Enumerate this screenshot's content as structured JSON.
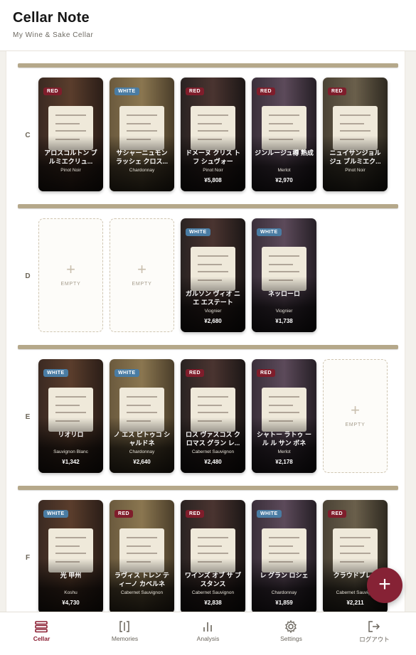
{
  "header": {
    "title": "Cellar Note",
    "subtitle": "My Wine & Sake Cellar"
  },
  "empty_label": "EMPTY",
  "empty_plus": "+",
  "fab_label": "+",
  "colors": {
    "accent": "#862235",
    "red_badge": "#7f1d2b",
    "white_badge": "#4a7ca3",
    "shelf": "#b5a88a"
  },
  "rows": [
    {
      "label": "C",
      "slots": [
        {
          "empty": false,
          "badge": "RED",
          "type": "red",
          "name": "アロスコルトン ブルミエクリュ...",
          "variety": "Pinot Noir",
          "price": ""
        },
        {
          "empty": false,
          "badge": "WHITE",
          "type": "white",
          "name": "サシャーニュモン ラッシェ クロス...",
          "variety": "Chardonnay",
          "price": ""
        },
        {
          "empty": false,
          "badge": "RED",
          "type": "red",
          "name": "ドメーヌ クリス トフ シュヴォー",
          "variety": "Pinot Noir",
          "price": "¥5,808"
        },
        {
          "empty": false,
          "badge": "RED",
          "type": "red",
          "name": "ジンルージュ樽 熟成",
          "variety": "Merlot",
          "price": "¥2,970"
        },
        {
          "empty": false,
          "badge": "RED",
          "type": "red",
          "name": "ニュイサンジョル ジュ ブルミエク...",
          "variety": "Pinot Noir",
          "price": ""
        }
      ]
    },
    {
      "label": "D",
      "slots": [
        {
          "empty": true
        },
        {
          "empty": true
        },
        {
          "empty": false,
          "badge": "WHITE",
          "type": "white",
          "name": "ガルソン ヴィオ ニエ エステート",
          "variety": "Viognier",
          "price": "¥2,680"
        },
        {
          "empty": false,
          "badge": "WHITE",
          "type": "white",
          "name": "ネッローロ",
          "variety": "Viognier",
          "price": "¥1,738"
        }
      ]
    },
    {
      "label": "E",
      "slots": [
        {
          "empty": false,
          "badge": "WHITE",
          "type": "white",
          "name": "リオリロ",
          "variety": "Sauvignon Blanc",
          "price": "¥1,342"
        },
        {
          "empty": false,
          "badge": "WHITE",
          "type": "white",
          "name": "ノ エス ピトゥコ シャルドネ",
          "variety": "Chardonnay",
          "price": "¥2,640"
        },
        {
          "empty": false,
          "badge": "RED",
          "type": "red",
          "name": "ロス ヴァスコス ク ロマス グラン レ...",
          "variety": "Cabernet Sauvignon",
          "price": "¥2,480"
        },
        {
          "empty": false,
          "badge": "RED",
          "type": "red",
          "name": "シャトー ラトゥ ール ル サン ボネ",
          "variety": "Merlot",
          "price": "¥2,178"
        },
        {
          "empty": true
        }
      ]
    },
    {
      "label": "F",
      "slots": [
        {
          "empty": false,
          "badge": "WHITE",
          "type": "white",
          "name": "光 甲州",
          "variety": "Koshu",
          "price": "¥4,730"
        },
        {
          "empty": false,
          "badge": "RED",
          "type": "red",
          "name": "ラヴィス トレン ティーノ カベルネ",
          "variety": "Cabernet Sauvignon",
          "price": ""
        },
        {
          "empty": false,
          "badge": "RED",
          "type": "red",
          "name": "ワインズ オブ サ ブスタンス",
          "variety": "Cabernet Sauvignon",
          "price": "¥2,838"
        },
        {
          "empty": false,
          "badge": "WHITE",
          "type": "white",
          "name": "レ グラン ロシェ",
          "variety": "Chardonnay",
          "price": "¥1,859"
        },
        {
          "empty": false,
          "badge": "RED",
          "type": "red",
          "name": "クラウドブレ...",
          "variety": "Cabernet Sauvig...",
          "price": "¥2,211"
        }
      ]
    }
  ],
  "bottom_nav": [
    {
      "label": "Cellar",
      "icon": "cellar-icon",
      "active": true
    },
    {
      "label": "Memories",
      "icon": "memories-icon",
      "active": false
    },
    {
      "label": "Analysis",
      "icon": "analysis-icon",
      "active": false
    },
    {
      "label": "Settings",
      "icon": "settings-icon",
      "active": false
    },
    {
      "label": "ログアウト",
      "icon": "logout-icon",
      "active": false
    }
  ]
}
